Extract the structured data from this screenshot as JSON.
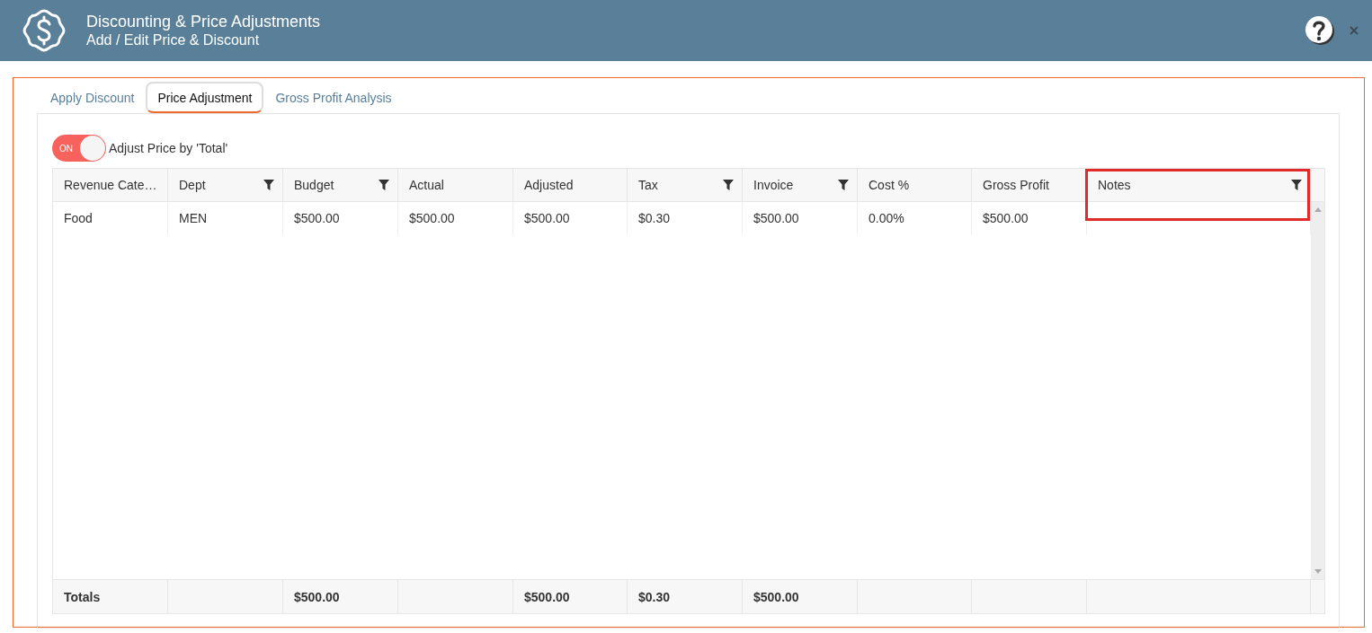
{
  "header": {
    "title": "Discounting & Price Adjustments",
    "subtitle": "Add / Edit Price & Discount"
  },
  "tabs": [
    {
      "label": "Apply Discount",
      "selected": false
    },
    {
      "label": "Price Adjustment",
      "selected": true
    },
    {
      "label": "Gross Profit Analysis",
      "selected": false
    }
  ],
  "toggle": {
    "on": true,
    "state_label": "ON",
    "label": "Adjust Price by 'Total'"
  },
  "table": {
    "columns": [
      {
        "label": "Revenue Cate…",
        "filter": false,
        "highlighted": false
      },
      {
        "label": "Dept",
        "filter": true,
        "highlighted": false
      },
      {
        "label": "Budget",
        "filter": true,
        "highlighted": false
      },
      {
        "label": "Actual",
        "filter": false,
        "highlighted": false
      },
      {
        "label": "Adjusted",
        "filter": false,
        "highlighted": false
      },
      {
        "label": "Tax",
        "filter": true,
        "highlighted": false
      },
      {
        "label": "Invoice",
        "filter": true,
        "highlighted": false
      },
      {
        "label": "Cost %",
        "filter": false,
        "highlighted": false
      },
      {
        "label": "Gross Profit",
        "filter": false,
        "highlighted": false
      },
      {
        "label": "Notes",
        "filter": true,
        "highlighted": true
      }
    ],
    "rows": [
      [
        "Food",
        "MEN",
        "$500.00",
        "$500.00",
        "$500.00",
        "$0.30",
        "$500.00",
        "0.00%",
        "$500.00",
        ""
      ]
    ],
    "totals": {
      "label": "Totals",
      "budget": "$500.00",
      "adjusted": "$500.00",
      "tax": "$0.30",
      "invoice": "$500.00"
    }
  }
}
